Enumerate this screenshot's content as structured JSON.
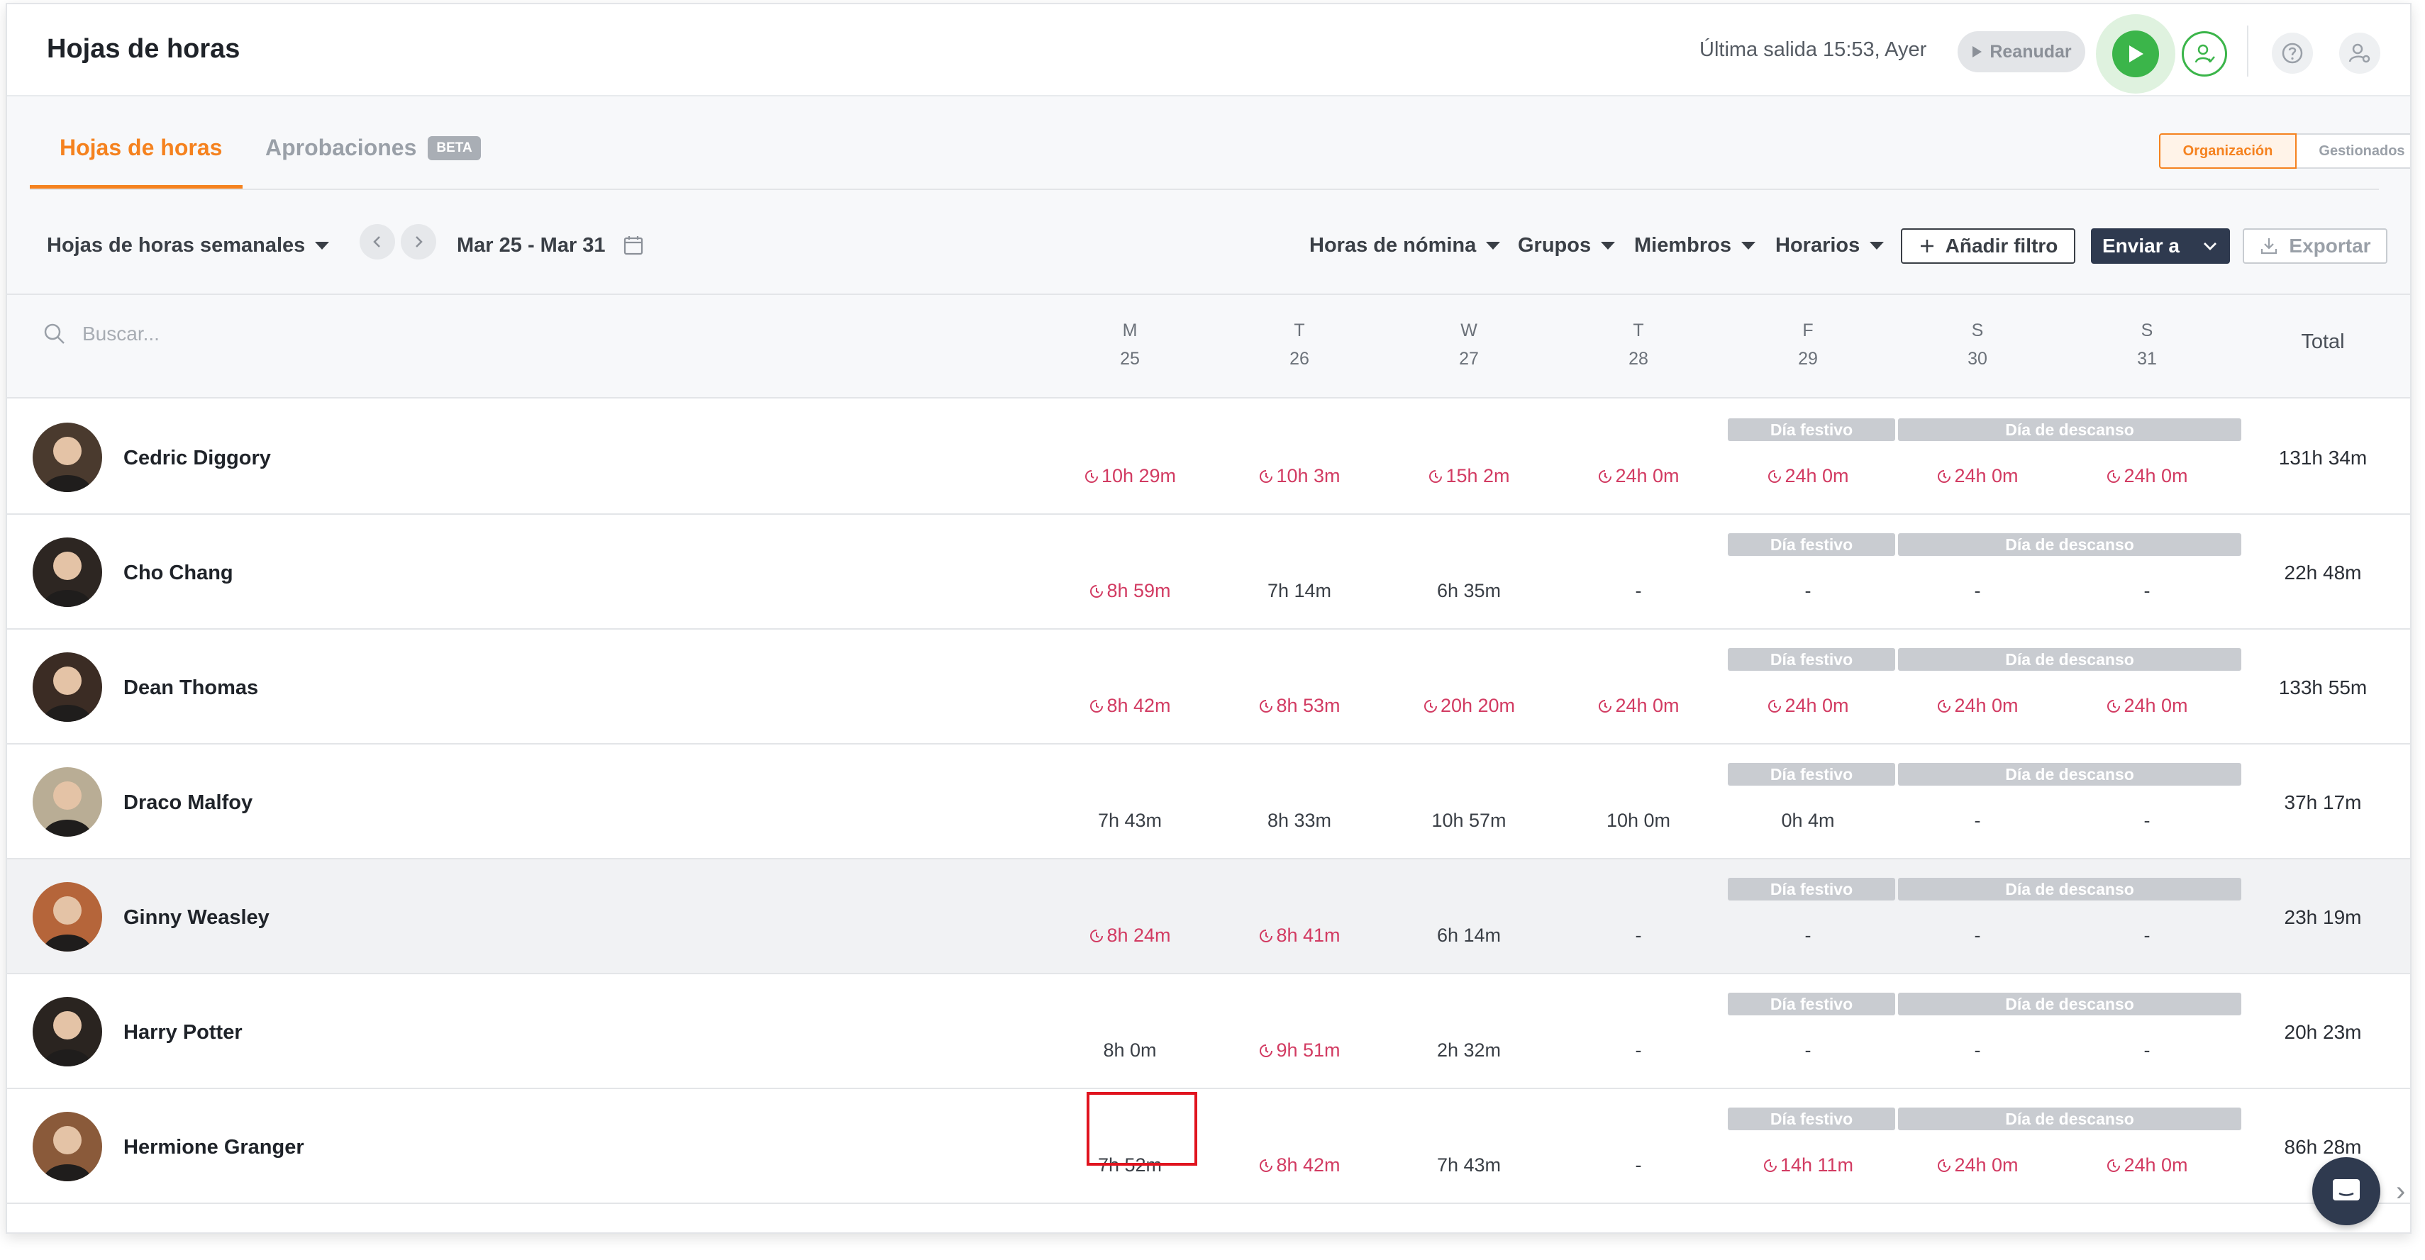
{
  "header": {
    "title": "Hojas de horas",
    "last_clock_out": "Última salida 15:53, Ayer",
    "resume_label": "Reanudar"
  },
  "tabs": [
    {
      "label": "Hojas de horas",
      "active": true
    },
    {
      "label": "Aprobaciones",
      "badge": "BETA",
      "active": false
    }
  ],
  "scope": {
    "organization": "Organización",
    "managed": "Gestionados"
  },
  "toolbar": {
    "view_select": "Hojas de horas semanales",
    "date_range": "Mar 25 - Mar 31",
    "payroll_hours": "Horas de nómina",
    "groups": "Grupos",
    "members": "Miembros",
    "schedules": "Horarios",
    "add_filter": "Añadir filtro",
    "send_to": "Enviar a",
    "export": "Exportar"
  },
  "search": {
    "placeholder": "Buscar..."
  },
  "days": [
    {
      "letter": "M",
      "date": "25"
    },
    {
      "letter": "T",
      "date": "26"
    },
    {
      "letter": "W",
      "date": "27"
    },
    {
      "letter": "T",
      "date": "28"
    },
    {
      "letter": "F",
      "date": "29"
    },
    {
      "letter": "S",
      "date": "30"
    },
    {
      "letter": "S",
      "date": "31"
    }
  ],
  "total_label": "Total",
  "holiday_label": "Día festivo",
  "rest_label": "Día de descanso",
  "colors": {
    "accent": "#f5821f",
    "overtime": "#d23b62",
    "play": "#3bb54a",
    "dark_button": "#2f3a4f"
  },
  "employees": [
    {
      "name": "Cedric Diggory",
      "avatar_bg": "#4a3a2e",
      "cells": [
        {
          "v": "10h 29m",
          "o": true
        },
        {
          "v": "10h 3m",
          "o": true
        },
        {
          "v": "15h 2m",
          "o": true
        },
        {
          "v": "24h 0m",
          "o": true
        },
        {
          "v": "24h 0m",
          "o": true
        },
        {
          "v": "24h 0m",
          "o": true
        },
        {
          "v": "24h 0m",
          "o": true
        }
      ],
      "total": "131h 34m"
    },
    {
      "name": "Cho Chang",
      "avatar_bg": "#2d2622",
      "cells": [
        {
          "v": "8h 59m",
          "o": true
        },
        {
          "v": "7h 14m",
          "o": false
        },
        {
          "v": "6h 35m",
          "o": false
        },
        {
          "v": "-",
          "o": false
        },
        {
          "v": "-",
          "o": false
        },
        {
          "v": "-",
          "o": false
        },
        {
          "v": "-",
          "o": false
        }
      ],
      "total": "22h 48m"
    },
    {
      "name": "Dean Thomas",
      "avatar_bg": "#3b2c24",
      "cells": [
        {
          "v": "8h 42m",
          "o": true
        },
        {
          "v": "8h 53m",
          "o": true
        },
        {
          "v": "20h 20m",
          "o": true
        },
        {
          "v": "24h 0m",
          "o": true
        },
        {
          "v": "24h 0m",
          "o": true
        },
        {
          "v": "24h 0m",
          "o": true
        },
        {
          "v": "24h 0m",
          "o": true
        }
      ],
      "total": "133h 55m"
    },
    {
      "name": "Draco Malfoy",
      "avatar_bg": "#b9ad95",
      "cells": [
        {
          "v": "7h 43m",
          "o": false
        },
        {
          "v": "8h 33m",
          "o": false
        },
        {
          "v": "10h 57m",
          "o": false
        },
        {
          "v": "10h 0m",
          "o": false
        },
        {
          "v": "0h 4m",
          "o": false
        },
        {
          "v": "-",
          "o": false
        },
        {
          "v": "-",
          "o": false
        }
      ],
      "total": "37h 17m"
    },
    {
      "name": "Ginny Weasley",
      "avatar_bg": "#b5653a",
      "cells": [
        {
          "v": "8h 24m",
          "o": true
        },
        {
          "v": "8h 41m",
          "o": true
        },
        {
          "v": "6h 14m",
          "o": false
        },
        {
          "v": "-",
          "o": false
        },
        {
          "v": "-",
          "o": false
        },
        {
          "v": "-",
          "o": false
        },
        {
          "v": "-",
          "o": false
        }
      ],
      "total": "23h 19m"
    },
    {
      "name": "Harry Potter",
      "avatar_bg": "#2a2420",
      "cells": [
        {
          "v": "8h 0m",
          "o": false
        },
        {
          "v": "9h 51m",
          "o": true
        },
        {
          "v": "2h 32m",
          "o": false
        },
        {
          "v": "-",
          "o": false
        },
        {
          "v": "-",
          "o": false
        },
        {
          "v": "-",
          "o": false
        },
        {
          "v": "-",
          "o": false
        }
      ],
      "total": "20h 23m"
    },
    {
      "name": "Hermione Granger",
      "avatar_bg": "#8a5a3a",
      "cells": [
        {
          "v": "7h 52m",
          "o": false
        },
        {
          "v": "8h 42m",
          "o": true
        },
        {
          "v": "7h 43m",
          "o": false
        },
        {
          "v": "-",
          "o": false
        },
        {
          "v": "14h 11m",
          "o": true
        },
        {
          "v": "24h 0m",
          "o": true
        },
        {
          "v": "24h 0m",
          "o": true
        }
      ],
      "total": "86h 28m"
    }
  ]
}
